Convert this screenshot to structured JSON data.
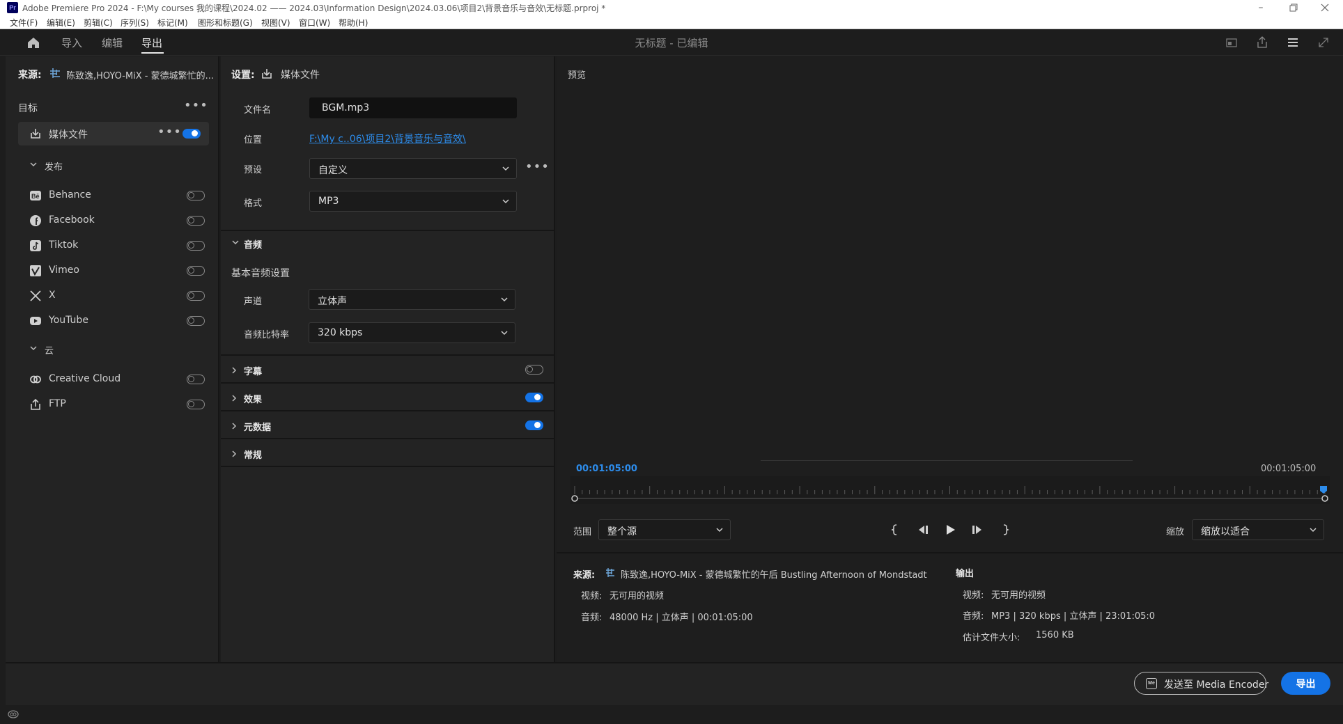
{
  "window": {
    "title": "Adobe Premiere Pro 2024 - F:\\My courses 我的课程\\2024.02 —— 2024.03\\Information Design\\2024.03.06\\项目2\\背景音乐与音效\\无标题.prproj *",
    "logo": "Pr"
  },
  "menu": [
    "文件(F)",
    "编辑(E)",
    "剪辑(C)",
    "序列(S)",
    "标记(M)",
    "图形和标题(G)",
    "视图(V)",
    "窗口(W)",
    "帮助(H)"
  ],
  "header": {
    "tabs": [
      "导入",
      "编辑",
      "导出"
    ],
    "active_tab": "导出",
    "doc_title": "无标题 - 已编辑"
  },
  "left": {
    "source_label": "来源:",
    "source_name": "陈致逸,HOYO-MiX - 蒙德城繁忙的...",
    "targets_label": "目标",
    "media_file": "媒体文件",
    "publish_label": "发布",
    "services": [
      "Behance",
      "Facebook",
      "Tiktok",
      "Vimeo",
      "X",
      "YouTube"
    ],
    "cloud_label": "云",
    "cloud_services": [
      "Creative Cloud",
      "FTP"
    ]
  },
  "settings": {
    "label": "设置:",
    "target": "媒体文件",
    "filename_label": "文件名",
    "filename": "BGM.mp3",
    "location_label": "位置",
    "location": "F:\\My c..06\\项目2\\背景音乐与音效\\",
    "preset_label": "预设",
    "preset": "自定义",
    "format_label": "格式",
    "format": "MP3",
    "audio_section": "音频",
    "basic_audio": "基本音频设置",
    "channels_label": "声道",
    "channels": "立体声",
    "bitrate_label": "音频比特率",
    "bitrate": "320 kbps",
    "captions": "字幕",
    "effects": "效果",
    "metadata": "元数据",
    "general": "常规"
  },
  "preview": {
    "label": "预览",
    "tc_in": "00:01:05:00",
    "tc_out": "00:01:05:00",
    "range_label": "范围",
    "range": "整个源",
    "zoom_label": "缩放",
    "zoom": "缩放以适合"
  },
  "summary": {
    "source_label": "来源:",
    "source_name": "陈致逸,HOYO-MiX - 蒙德城繁忙的午后 Bustling Afternoon of Mondstadt",
    "video_label": "视频:",
    "video_none": "无可用的视频",
    "audio_label": "音频:",
    "source_audio": "48000 Hz | 立体声 | 00:01:05:00",
    "output_label": "输出",
    "out_video_label": "视频:",
    "out_video": "无可用的视频",
    "out_audio_label": "音频:",
    "out_audio": "MP3 | 320 kbps | 立体声 | 23:01:05:0",
    "size_label": "估计文件大小:",
    "size": "1560 KB"
  },
  "buttons": {
    "send": "发送至 Media Encoder",
    "send_icon": "Me",
    "export": "导出"
  },
  "colors": {
    "accent": "#1473e6",
    "link": "#2d8ceb"
  }
}
